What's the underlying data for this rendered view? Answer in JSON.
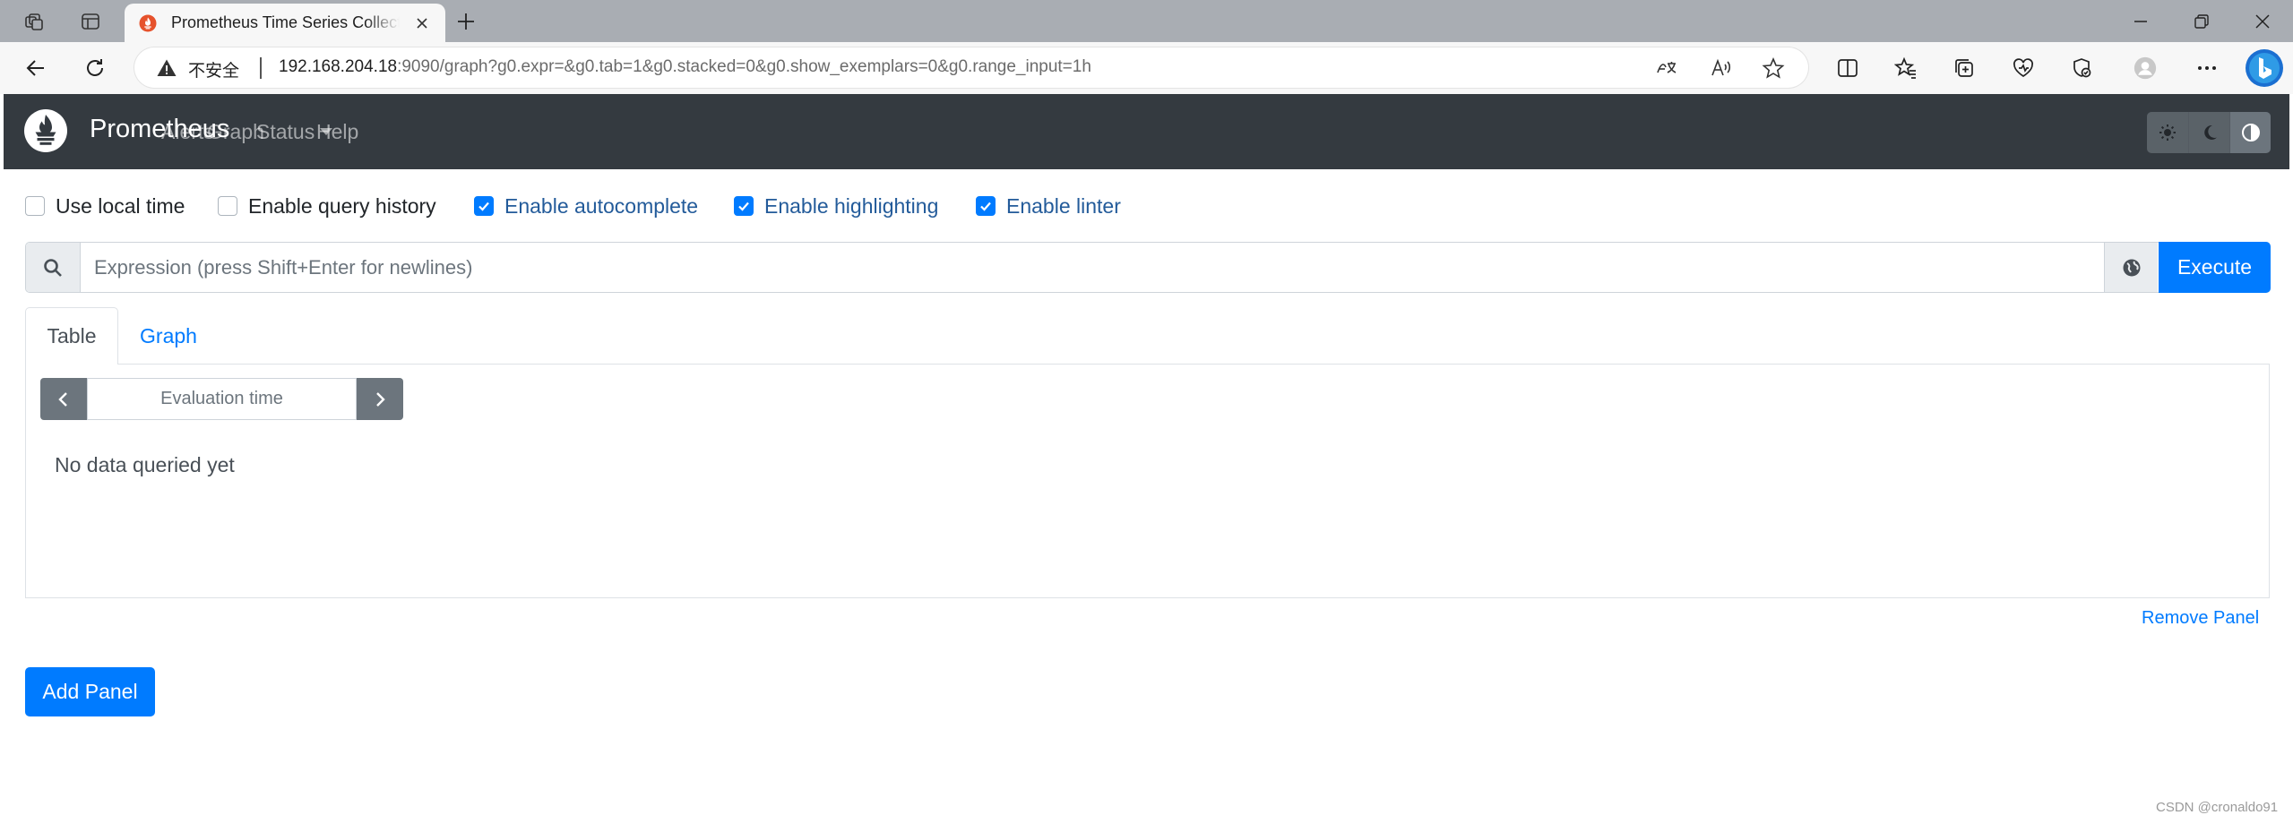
{
  "browser": {
    "tab_title": "Prometheus Time Series Collection and Processing Server",
    "address": {
      "security_label": "不安全",
      "url_host": "192.168.204.18",
      "url_rest": ":9090/graph?g0.expr=&g0.tab=1&g0.stacked=0&g0.show_exemplars=0&g0.range_input=1h"
    },
    "icons": {
      "workspaces": "workspaces-icon",
      "tab_actions": "tab-actions-icon",
      "read_aloud": "read-aloud-icon",
      "translate": "translate-icon",
      "favorite": "star-icon"
    }
  },
  "navbar": {
    "brand": "Prometheus",
    "links": {
      "alerts": "Alerts",
      "graph": "Graph",
      "status": "Status",
      "help": "Help"
    }
  },
  "options": {
    "use_local_time": {
      "label": "Use local time",
      "checked": false
    },
    "enable_query_history": {
      "label": "Enable query history",
      "checked": false
    },
    "enable_autocomplete": {
      "label": "Enable autocomplete",
      "checked": true
    },
    "enable_highlighting": {
      "label": "Enable highlighting",
      "checked": true
    },
    "enable_linter": {
      "label": "Enable linter",
      "checked": true
    }
  },
  "query": {
    "placeholder": "Expression (press Shift+Enter for newlines)",
    "value": "",
    "execute_label": "Execute"
  },
  "panel": {
    "tabs": {
      "table": "Table",
      "graph": "Graph"
    },
    "eval_placeholder": "Evaluation time",
    "empty_message": "No data queried yet",
    "remove_label": "Remove Panel"
  },
  "add_panel_label": "Add Panel",
  "watermark": "CSDN @cronaldo91",
  "colors": {
    "primary": "#007bff",
    "navbar": "#343a40",
    "checked_label": "#235b9a"
  }
}
